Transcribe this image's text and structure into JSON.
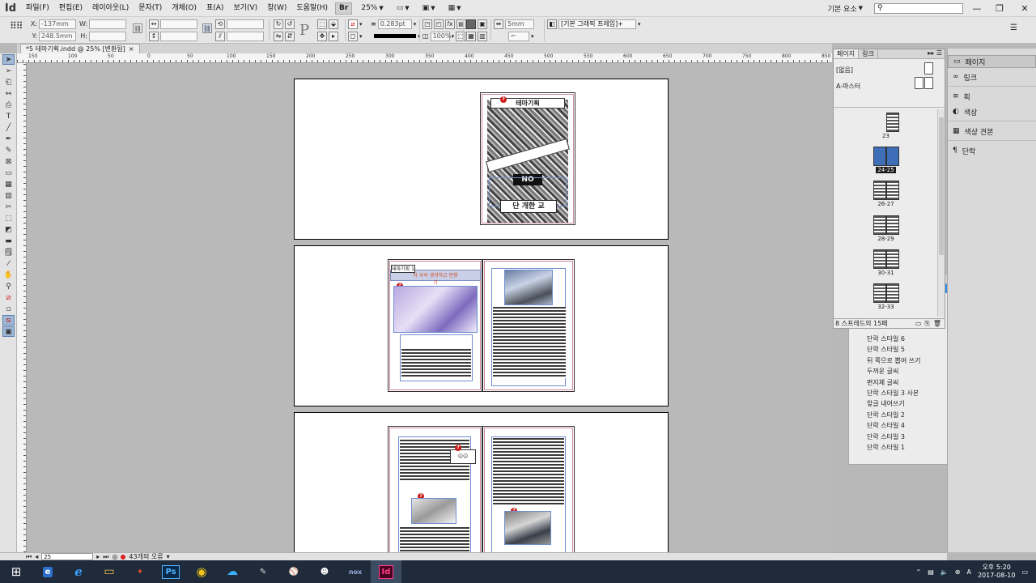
{
  "app": {
    "logo": "Id",
    "workspace": "기본 요소"
  },
  "menu": [
    "파일(F)",
    "편집(E)",
    "레이아웃(L)",
    "문자(T)",
    "개체(O)",
    "표(A)",
    "보기(V)",
    "창(W)",
    "도움말(H)"
  ],
  "toolbar": {
    "bridge": "Br",
    "zoom": "25%"
  },
  "control": {
    "x_value": "-137mm",
    "y_value": "248.5mm",
    "stroke_weight": "0.283pt",
    "scale": "100%",
    "gap": "5mm",
    "frame_style": "[기본 그래픽 프레임]+",
    "labels": {
      "x": "X:",
      "y": "Y:",
      "w": "W:",
      "h": "H:"
    }
  },
  "document": {
    "tab_title": "*5 테마기획.indd @ 25% [변환됨]",
    "close": "×"
  },
  "ruler_ticks": [
    "150",
    "100",
    "50",
    "0",
    "50",
    "100",
    "150",
    "200",
    "250",
    "300",
    "350",
    "400",
    "450",
    "500",
    "550",
    "600",
    "650",
    "700",
    "750",
    "800",
    "850"
  ],
  "pages_panel": {
    "tabs": [
      "페이지",
      "링크"
    ],
    "none_label": "[없음]",
    "master_label": "A-마스터",
    "spreads": [
      {
        "label": "23",
        "selected": false,
        "pages": 1
      },
      {
        "label": "24-25",
        "selected": true,
        "pages": 2
      },
      {
        "label": "26-27",
        "selected": false,
        "pages": 2
      },
      {
        "label": "28-29",
        "selected": false,
        "pages": 2
      },
      {
        "label": "30-31",
        "selected": false,
        "pages": 2
      },
      {
        "label": "32-33",
        "selected": false,
        "pages": 2
      }
    ],
    "status": "8 스프레드의 15페"
  },
  "styles_panel": {
    "items": [
      "단락 스타일 6",
      "단락 스타일 5",
      "뒤 쪽으로 뽑여 쓰기",
      "두꺼운 글씨",
      "편지체 글씨",
      "단락 스타일 3 사본",
      "앞글 내어쓰기",
      "단락 스타일 2",
      "단락 스타일 4",
      "단락 스타일 3",
      "단락 스타일 1"
    ]
  },
  "dock": {
    "items": [
      {
        "label": "페이지",
        "icon": "pages-icon",
        "glyph": "▭"
      },
      {
        "label": "링크",
        "icon": "links-icon",
        "glyph": "∞"
      },
      {
        "label": "획",
        "icon": "stroke-icon",
        "glyph": "≡"
      },
      {
        "label": "색상",
        "icon": "color-icon",
        "glyph": "◐"
      },
      {
        "label": "색상 견본",
        "icon": "swatches-icon",
        "glyph": "▦"
      },
      {
        "label": "단락",
        "icon": "paragraph-icon",
        "glyph": "¶"
      }
    ]
  },
  "spread1": {
    "stamp1": "테마기획",
    "stamp2": "NO",
    "stamp3": "단 개한 교 "
  },
  "spread2": {
    "header_tag": "테마기획 1",
    "header_title": "처 우리 생겨하고 만향기"
  },
  "status_bar": {
    "page": "25",
    "errors": "43개의 오류"
  },
  "taskbar": {
    "apps": [
      "Ps",
      "Id"
    ],
    "time": "오후 5:20",
    "date": "2017-08-10"
  }
}
